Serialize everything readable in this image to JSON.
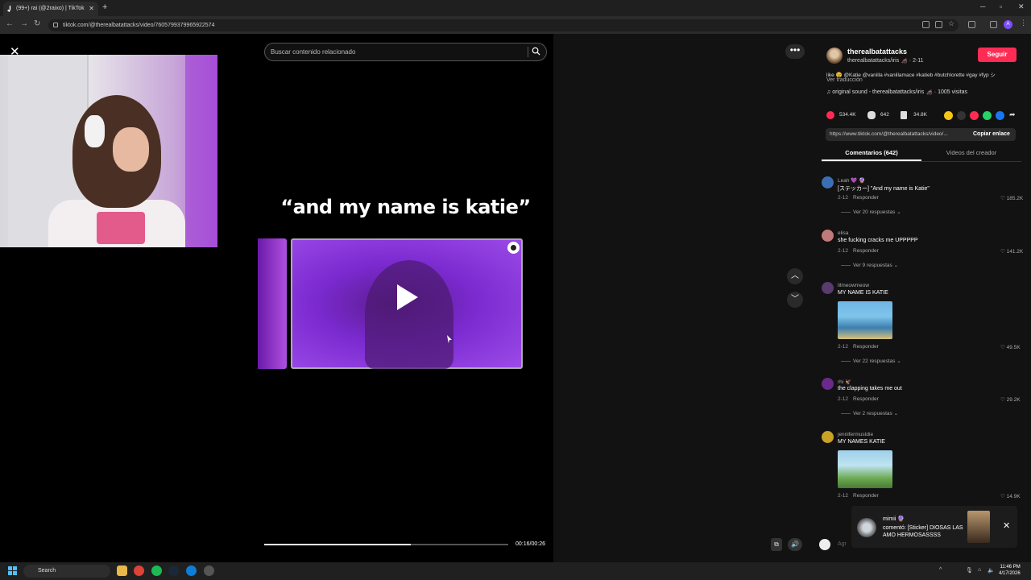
{
  "browser": {
    "tab_title": "(99+) rai (@2raixo) | TikTok",
    "url": "tiktok.com/@therealbatattacks/video/7605799379965922574",
    "profile_initial": "A"
  },
  "search": {
    "placeholder": "Buscar contenido relacionado"
  },
  "video": {
    "caption": "“and my name is katie”",
    "time": "00:16/00:26",
    "progress": 0.6
  },
  "author": {
    "username": "therealbatattacks",
    "subline": "therealbatattacks/iris 🦽 · 2-11",
    "follow_label": "Seguir",
    "description": "like 😵 @Katie @vanilla #vanillamace #katieb #butchlorette #gay #fyp シ",
    "translate_label": "Ver traducción",
    "sound": "♫ original sound - therealbatattacks/iris 🦽 · 1005 visitas"
  },
  "stats": {
    "likes": "534.4K",
    "comments": "642",
    "saves": "34.8K"
  },
  "share": {
    "link": "https://www.tiktok.com/@therealbatattacks/video/...",
    "copy_label": "Copiar enlace"
  },
  "tabs": {
    "comments": "Comentarios (642)",
    "creator": "Videos del creador"
  },
  "comments": [
    {
      "user": "Leah 💜 🔮",
      "text": "[ステッカー] \"And my name is Katie\"",
      "date": "2-12",
      "reply": "Responder",
      "likes": "♡ 185.2K",
      "more": "Ver 20 respuestas ⌄"
    },
    {
      "user": "elisa",
      "text": "she fucking cracks me UPPPPP",
      "date": "2-12",
      "reply": "Responder",
      "likes": "♡ 141.2K",
      "more": "Ver 9 respuestas ⌄"
    },
    {
      "user": "lilmeowmeow",
      "text": "MY NAME IS KATIE",
      "date": "2-12",
      "reply": "Responder",
      "likes": "♡ 49.5K",
      "more": "Ver 22 respuestas ⌄"
    },
    {
      "user": "rhi 🦅",
      "text": "the clapping takes me out",
      "date": "2-12",
      "reply": "Responder",
      "likes": "♡ 29.2K",
      "more": "Ver 2 respuestas ⌄"
    },
    {
      "user": "jennifermustdie",
      "text": "MY NAMES KATIE",
      "date": "2-12",
      "reply": "Responder",
      "likes": "♡ 14.9K"
    }
  ],
  "composer": {
    "placeholder": "Agr"
  },
  "toast": {
    "user": "mimii 🔮",
    "text": "comentó: [Sticker] DIOSAS LAS AMO HERMOSASSSS"
  },
  "taskbar": {
    "search_label": "Search",
    "time": "11:46 PM",
    "date": "4/17/2026"
  },
  "colors": {
    "follow": "#fe2c55",
    "accent_purple": "#9c4be8"
  }
}
